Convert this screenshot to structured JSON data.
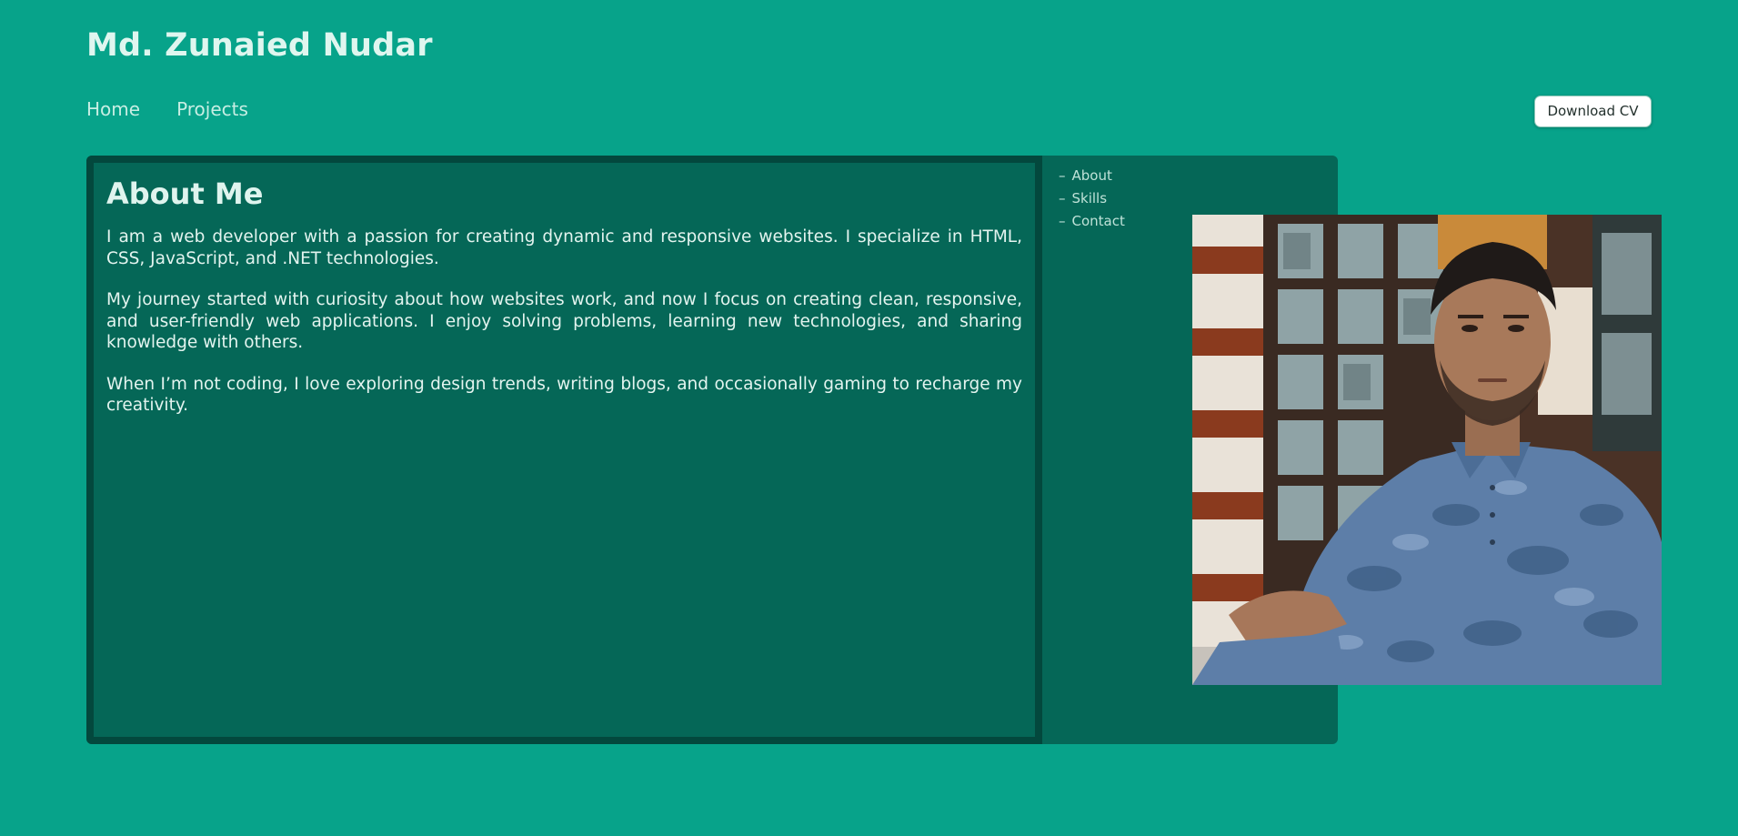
{
  "header": {
    "site_title": "Md. Zunaied Nudar"
  },
  "nav": {
    "items": [
      {
        "label": "Home"
      },
      {
        "label": "Projects"
      }
    ]
  },
  "actions": {
    "download_cv_label": "Download CV"
  },
  "about": {
    "heading": "About Me",
    "paragraphs": [
      "I am a web developer with a passion for creating dynamic and responsive websites. I specialize in HTML, CSS, JavaScript, and .NET technologies.",
      "My journey started with curiosity about how websites work, and now I focus on creating clean, responsive, and user-friendly web applications. I enjoy solving problems, learning new technologies, and sharing knowledge with others.",
      "When I’m not coding, I love exploring design trends, writing blogs, and occasionally gaming to recharge my creativity."
    ]
  },
  "side_nav": {
    "items": [
      {
        "dash": "–",
        "label": "About"
      },
      {
        "dash": "–",
        "label": "Skills"
      },
      {
        "dash": "–",
        "label": "Contact"
      }
    ]
  },
  "colors": {
    "page_background": "#07a38a",
    "panel_background": "#056757",
    "card_border": "#03483d"
  }
}
